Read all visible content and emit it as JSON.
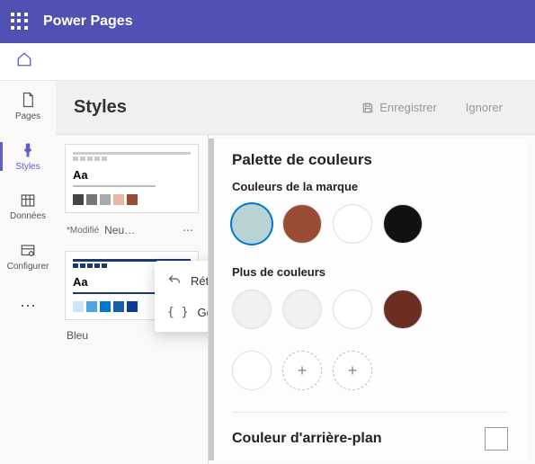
{
  "header": {
    "app_name": "Power Pages"
  },
  "leftnav": {
    "pages": "Pages",
    "styles": "Styles",
    "data": "Données",
    "configure": "Configurer"
  },
  "titlebar": {
    "title": "Styles",
    "save": "Enregistrer",
    "ignore": "Ignorer"
  },
  "themes": {
    "card1": {
      "modified": "*Modifié",
      "name": "Neu…"
    },
    "card2": {
      "name": "Bleu"
    }
  },
  "context_menu": {
    "reset": "Rétablir les valeurs par défaut",
    "manage_css": "Gérer CSS"
  },
  "palette": {
    "section_title": "Palette de couleurs",
    "brand_title": "Couleurs de la marque",
    "more_title": "Plus de couleurs",
    "bg_title": "Couleur d'arrière-plan",
    "brand_colors": [
      "#b9d3d5",
      "#9a4b34",
      "#ffffff",
      "#111111"
    ],
    "more_colors_row1": [
      "#f0f0f0",
      "#f0f0f0",
      "#ffffff",
      "#6b2f22"
    ],
    "more_colors_row2": [
      "#ffffff"
    ],
    "bg_color": "#ffffff"
  }
}
